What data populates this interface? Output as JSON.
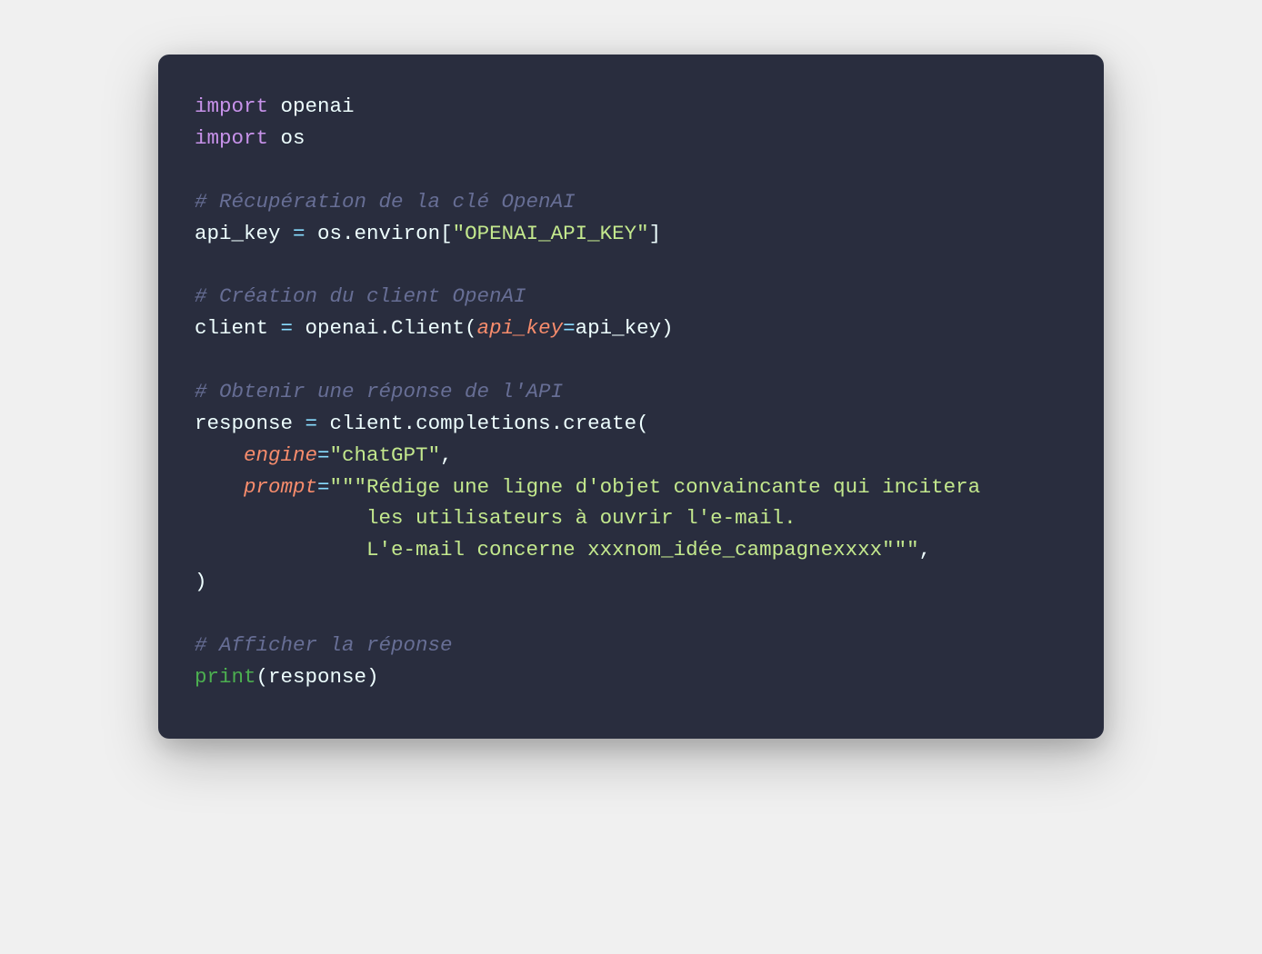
{
  "code": {
    "line1": {
      "import": "import",
      "module": " openai"
    },
    "line2": {
      "import": "import",
      "module": " os"
    },
    "comment1": "# Récupération de la clé OpenAI",
    "line4": {
      "var": "api_key ",
      "op": "=",
      "rest": " os.environ[",
      "str": "\"OPENAI_API_KEY\"",
      "close": "]"
    },
    "comment2": "# Création du client OpenAI",
    "line6": {
      "var": "client ",
      "op": "=",
      "mod": " openai.Client(",
      "param": "api_key",
      "eq": "=",
      "val": "api_key)"
    },
    "comment3": "# Obtenir une réponse de l'API",
    "line8": {
      "var": "response ",
      "op": "=",
      "rest": " client.completions.create("
    },
    "line9": {
      "indent": "    ",
      "param": "engine",
      "eq": "=",
      "str": "\"chatGPT\"",
      "comma": ","
    },
    "line10": {
      "indent": "    ",
      "param": "prompt",
      "eq": "=",
      "str": "\"\"\"Rédige une ligne d'objet convaincante qui incitera"
    },
    "line11": {
      "str": "              les utilisateurs à ouvrir l'e-mail."
    },
    "line12": {
      "str": "              L'e-mail concerne xxxnom_idée_campagnexxxx\"\"\"",
      "comma": ","
    },
    "line13": ")",
    "comment4": "# Afficher la réponse",
    "line15": {
      "fn": "print",
      "open": "(",
      "arg": "response",
      "close": ")"
    }
  }
}
